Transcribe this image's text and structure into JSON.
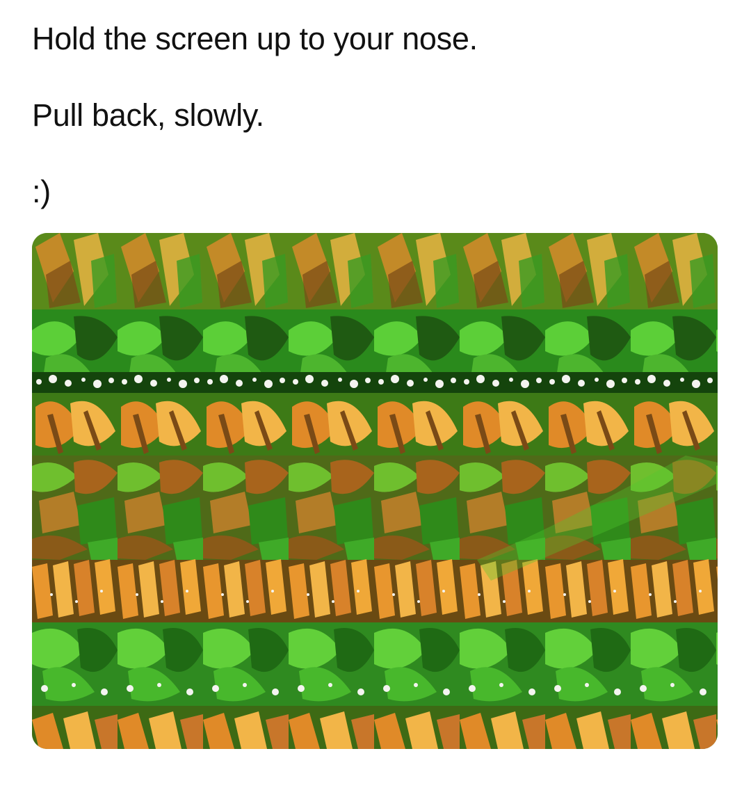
{
  "caption": {
    "line1": "Hold the screen up to your nose.",
    "line2": "Pull back, slowly.",
    "line3": ":)"
  },
  "image": {
    "description_name": "autostereogram",
    "palette": {
      "leaf_dark": "#1f5a12",
      "leaf_mid": "#3a9a22",
      "leaf_light": "#6fd23a",
      "wing_orange": "#e08a28",
      "wing_yellow": "#f2b548",
      "wing_brown": "#7a4a16",
      "spot_white": "#f4f4f0"
    }
  }
}
